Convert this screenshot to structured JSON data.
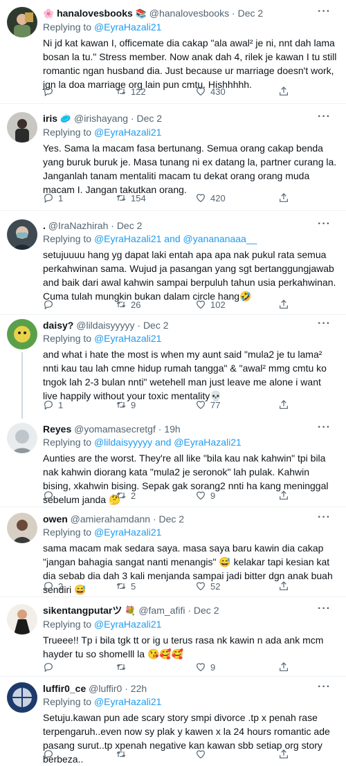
{
  "tweets": [
    {
      "name": "hanalovesbooks",
      "name_emoji_before": "🌸",
      "name_emoji_after": "📚",
      "handle": "@hanalovesbooks",
      "time": "Dec 2",
      "replying_label": "Replying to",
      "replying_to": "@EyraHazali21",
      "text": "Ni jd kat kawan I, officemate dia cakap \"ala awal² je ni, nnt dah lama bosan la tu.\" Stress member. Now anak dah 4, rilek je kawan I tu still romantic ngan husband dia. Just because ur marriage doesn't work, jgn la doa marriage org lain pun cmtu. Hishhhhh.",
      "replies": "",
      "retweets": "122",
      "likes": "430"
    },
    {
      "name": "iris",
      "name_emoji_after": "🥏",
      "handle": "@irishayang",
      "time": "Dec 2",
      "replying_label": "Replying to",
      "replying_to": "@EyraHazali21",
      "text": "Yes. Sama la macam fasa bertunang. Semua orang cakap benda yang buruk buruk je. Masa tunang ni ex datang la, partner curang la. Janganlah tanam mentaliti macam tu dekat orang orang muda macam I. Jangan takutkan orang.",
      "replies": "1",
      "retweets": "154",
      "likes": "420"
    },
    {
      "name": ".",
      "handle": "@IraNazhirah",
      "time": "Dec 2",
      "replying_label": "Replying to",
      "replying_to": "@EyraHazali21 and @yanananaaa__",
      "text": "setujuuuu hang yg dapat laki entah apa apa nak pukul rata semua perkahwinan sama. Wujud ja pasangan yang sgt bertanggungjawab and baik dari awal kahwin sampai berpuluh tahun usia perkahwinan. Cuma tulah mungkin bukan dalam circle hang🤣",
      "replies": "",
      "retweets": "26",
      "likes": "102"
    },
    {
      "name": "daisy?",
      "handle": "@lildaisyyyyy",
      "time": "Dec 2",
      "replying_label": "Replying to",
      "replying_to": "@EyraHazali21",
      "text": "and what i hate the most is when my aunt said \"mula2 je tu lama² nnti kau tau lah cmne hidup rumah tangga\" & \"awal² mmg cmtu ko tngok lah 2-3 bulan nnti\" wetehell man just leave me alone i want live happily without your toxic mentality💀",
      "replies": "1",
      "retweets": "9",
      "likes": "77"
    },
    {
      "name": "Reyes",
      "handle": "@yomamasecretgf",
      "time": "19h",
      "replying_label": "Replying to",
      "replying_to": "@lildaisyyyyy and @EyraHazali21",
      "text": "Aunties are the worst. They're all like \"bila kau nak kahwin\" tpi bila nak kahwin diorang kata \"mula2 je seronok\" lah pulak. Kahwin bising, xkahwin bising. Sepak gak sorang2 nnti ha kang meninggal sebelum janda 🤔",
      "replies": "",
      "retweets": "2",
      "likes": "9"
    },
    {
      "name": "owen",
      "handle": "@amierahamdann",
      "time": "Dec 2",
      "replying_label": "Replying to",
      "replying_to": "@EyraHazali21",
      "text": "sama macam mak sedara saya. masa saya baru kawin dia cakap \"jangan bahagia sangat nanti menangis\" 😅 kelakar tapi kesian kat dia sebab dia dah 3 kali menjanda sampai jadi bitter dgn anak buah sendiri 😅",
      "replies": "2",
      "retweets": "5",
      "likes": "52"
    },
    {
      "name": "sikentangputarツ",
      "name_emoji_after": "💐",
      "handle": "@fam_afifi",
      "time": "Dec 2",
      "replying_label": "Replying to",
      "replying_to": "@EyraHazali21",
      "text": "Trueee!! Tp i bila tgk tt or ig u terus rasa nk kawin n ada ank mcm hayder tu so shomelll la 😘🥰🥰",
      "replies": "",
      "retweets": "",
      "likes": "9"
    },
    {
      "name": "luffir0_ce",
      "handle": "@luffir0",
      "time": "22h",
      "replying_label": "Replying to",
      "replying_to": "@EyraHazali21",
      "text": "Setuju.kawan pun ade scary story smpi divorce .tp x penah rase terpengaruh..even now sy plak y kawen x la 24 hours romantic ade pasang surut..tp xpenah negative kan kawan sbb setiap org story berbeza..",
      "replies": "",
      "retweets": "",
      "likes": ""
    }
  ],
  "colors": {
    "accent": "#1d9bf0",
    "secondary_text": "#536471",
    "divider": "#eff3f4"
  },
  "icons": {
    "reply": "reply-icon",
    "retweet": "retweet-icon",
    "like": "heart-icon",
    "share": "share-icon",
    "more": "more-icon"
  }
}
